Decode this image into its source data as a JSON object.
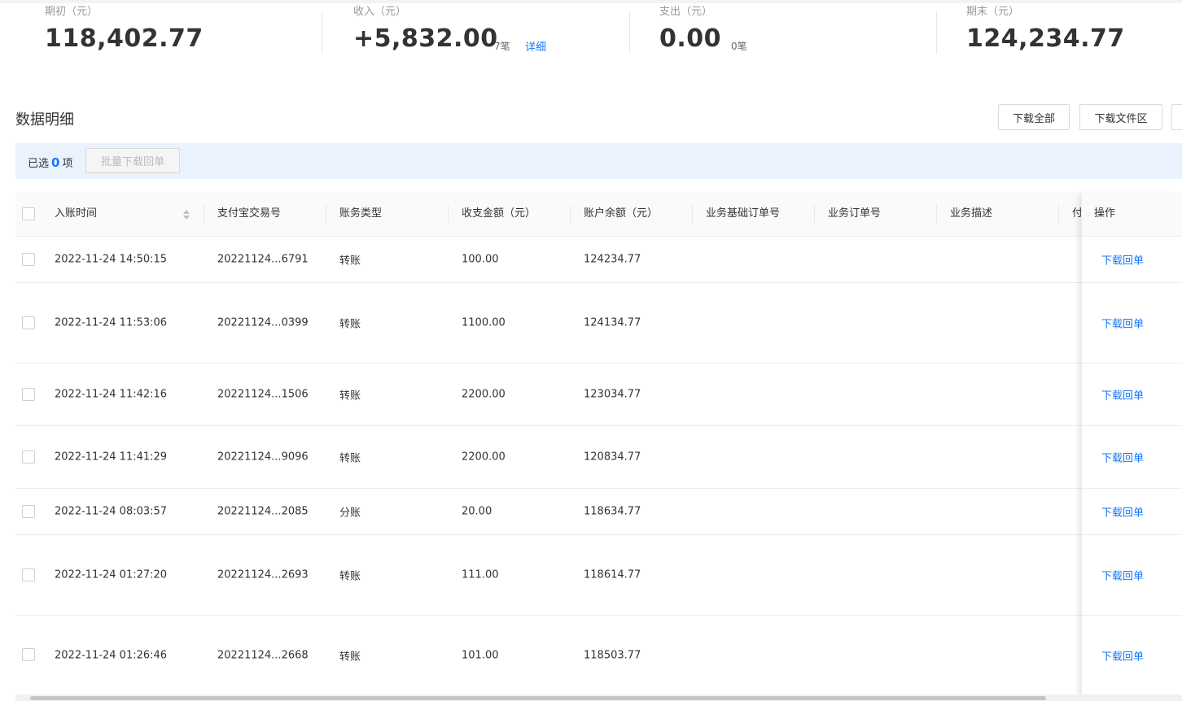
{
  "summary": {
    "opening": {
      "label": "期初（元）",
      "value": "118,402.77"
    },
    "income": {
      "label": "收入（元）",
      "value": "+5,832.00",
      "count": "7笔",
      "detail_link": "详细"
    },
    "expense": {
      "label": "支出（元）",
      "value": "0.00",
      "count": "0笔"
    },
    "closing": {
      "label": "期末（元）",
      "value": "124,234.77"
    }
  },
  "section": {
    "title": "数据明细",
    "download_all": "下载全部",
    "download_files": "下载文件区"
  },
  "selection": {
    "prefix": "已选",
    "count": "0",
    "suffix": "项",
    "batch_button": "批量下载回单"
  },
  "table": {
    "columns": [
      "入账时间",
      "支付宝交易号",
      "账务类型",
      "收支金额（元）",
      "账户余额（元）",
      "业务基础订单号",
      "业务订单号",
      "业务描述",
      "付"
    ],
    "action_header": "操作",
    "rows": [
      {
        "time": "2022-11-24 14:50:15",
        "trade_no": "20221124...6791",
        "type": "转账",
        "amount": "100.00",
        "balance": "124234.77",
        "action": "下载回单"
      },
      {
        "time": "2022-11-24 11:53:06",
        "trade_no": "20221124...0399",
        "type": "转账",
        "amount": "1100.00",
        "balance": "124134.77",
        "action": "下载回单"
      },
      {
        "time": "2022-11-24 11:42:16",
        "trade_no": "20221124...1506",
        "type": "转账",
        "amount": "2200.00",
        "balance": "123034.77",
        "action": "下载回单"
      },
      {
        "time": "2022-11-24 11:41:29",
        "trade_no": "20221124...9096",
        "type": "转账",
        "amount": "2200.00",
        "balance": "120834.77",
        "action": "下载回单"
      },
      {
        "time": "2022-11-24 08:03:57",
        "trade_no": "20221124...2085",
        "type": "分账",
        "amount": "20.00",
        "balance": "118634.77",
        "action": "下载回单"
      },
      {
        "time": "2022-11-24 01:27:20",
        "trade_no": "20221124...2693",
        "type": "转账",
        "amount": "111.00",
        "balance": "118614.77",
        "action": "下载回单"
      },
      {
        "time": "2022-11-24 01:26:46",
        "trade_no": "20221124...2668",
        "type": "转账",
        "amount": "101.00",
        "balance": "118503.77",
        "action": "下载回单"
      }
    ]
  },
  "colors": {
    "accent": "#1677ff",
    "selection_bg": "#eaf2fd"
  }
}
